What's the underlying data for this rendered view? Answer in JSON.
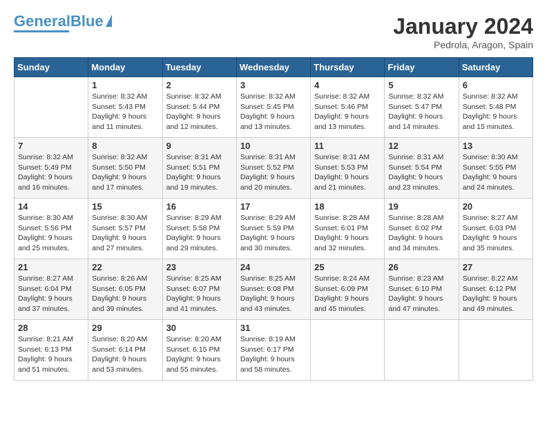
{
  "header": {
    "logo_general": "General",
    "logo_blue": "Blue",
    "month_title": "January 2024",
    "subtitle": "Pedrola, Aragon, Spain"
  },
  "weekdays": [
    "Sunday",
    "Monday",
    "Tuesday",
    "Wednesday",
    "Thursday",
    "Friday",
    "Saturday"
  ],
  "weeks": [
    [
      {
        "day": "",
        "sunrise": "",
        "sunset": "",
        "daylight": ""
      },
      {
        "day": "1",
        "sunrise": "Sunrise: 8:32 AM",
        "sunset": "Sunset: 5:43 PM",
        "daylight": "Daylight: 9 hours and 11 minutes."
      },
      {
        "day": "2",
        "sunrise": "Sunrise: 8:32 AM",
        "sunset": "Sunset: 5:44 PM",
        "daylight": "Daylight: 9 hours and 12 minutes."
      },
      {
        "day": "3",
        "sunrise": "Sunrise: 8:32 AM",
        "sunset": "Sunset: 5:45 PM",
        "daylight": "Daylight: 9 hours and 13 minutes."
      },
      {
        "day": "4",
        "sunrise": "Sunrise: 8:32 AM",
        "sunset": "Sunset: 5:46 PM",
        "daylight": "Daylight: 9 hours and 13 minutes."
      },
      {
        "day": "5",
        "sunrise": "Sunrise: 8:32 AM",
        "sunset": "Sunset: 5:47 PM",
        "daylight": "Daylight: 9 hours and 14 minutes."
      },
      {
        "day": "6",
        "sunrise": "Sunrise: 8:32 AM",
        "sunset": "Sunset: 5:48 PM",
        "daylight": "Daylight: 9 hours and 15 minutes."
      }
    ],
    [
      {
        "day": "7",
        "sunrise": "Sunrise: 8:32 AM",
        "sunset": "Sunset: 5:49 PM",
        "daylight": "Daylight: 9 hours and 16 minutes."
      },
      {
        "day": "8",
        "sunrise": "Sunrise: 8:32 AM",
        "sunset": "Sunset: 5:50 PM",
        "daylight": "Daylight: 9 hours and 17 minutes."
      },
      {
        "day": "9",
        "sunrise": "Sunrise: 8:31 AM",
        "sunset": "Sunset: 5:51 PM",
        "daylight": "Daylight: 9 hours and 19 minutes."
      },
      {
        "day": "10",
        "sunrise": "Sunrise: 8:31 AM",
        "sunset": "Sunset: 5:52 PM",
        "daylight": "Daylight: 9 hours and 20 minutes."
      },
      {
        "day": "11",
        "sunrise": "Sunrise: 8:31 AM",
        "sunset": "Sunset: 5:53 PM",
        "daylight": "Daylight: 9 hours and 21 minutes."
      },
      {
        "day": "12",
        "sunrise": "Sunrise: 8:31 AM",
        "sunset": "Sunset: 5:54 PM",
        "daylight": "Daylight: 9 hours and 23 minutes."
      },
      {
        "day": "13",
        "sunrise": "Sunrise: 8:30 AM",
        "sunset": "Sunset: 5:55 PM",
        "daylight": "Daylight: 9 hours and 24 minutes."
      }
    ],
    [
      {
        "day": "14",
        "sunrise": "Sunrise: 8:30 AM",
        "sunset": "Sunset: 5:56 PM",
        "daylight": "Daylight: 9 hours and 25 minutes."
      },
      {
        "day": "15",
        "sunrise": "Sunrise: 8:30 AM",
        "sunset": "Sunset: 5:57 PM",
        "daylight": "Daylight: 9 hours and 27 minutes."
      },
      {
        "day": "16",
        "sunrise": "Sunrise: 8:29 AM",
        "sunset": "Sunset: 5:58 PM",
        "daylight": "Daylight: 9 hours and 29 minutes."
      },
      {
        "day": "17",
        "sunrise": "Sunrise: 8:29 AM",
        "sunset": "Sunset: 5:59 PM",
        "daylight": "Daylight: 9 hours and 30 minutes."
      },
      {
        "day": "18",
        "sunrise": "Sunrise: 8:28 AM",
        "sunset": "Sunset: 6:01 PM",
        "daylight": "Daylight: 9 hours and 32 minutes."
      },
      {
        "day": "19",
        "sunrise": "Sunrise: 8:28 AM",
        "sunset": "Sunset: 6:02 PM",
        "daylight": "Daylight: 9 hours and 34 minutes."
      },
      {
        "day": "20",
        "sunrise": "Sunrise: 8:27 AM",
        "sunset": "Sunset: 6:03 PM",
        "daylight": "Daylight: 9 hours and 35 minutes."
      }
    ],
    [
      {
        "day": "21",
        "sunrise": "Sunrise: 8:27 AM",
        "sunset": "Sunset: 6:04 PM",
        "daylight": "Daylight: 9 hours and 37 minutes."
      },
      {
        "day": "22",
        "sunrise": "Sunrise: 8:26 AM",
        "sunset": "Sunset: 6:05 PM",
        "daylight": "Daylight: 9 hours and 39 minutes."
      },
      {
        "day": "23",
        "sunrise": "Sunrise: 8:25 AM",
        "sunset": "Sunset: 6:07 PM",
        "daylight": "Daylight: 9 hours and 41 minutes."
      },
      {
        "day": "24",
        "sunrise": "Sunrise: 8:25 AM",
        "sunset": "Sunset: 6:08 PM",
        "daylight": "Daylight: 9 hours and 43 minutes."
      },
      {
        "day": "25",
        "sunrise": "Sunrise: 8:24 AM",
        "sunset": "Sunset: 6:09 PM",
        "daylight": "Daylight: 9 hours and 45 minutes."
      },
      {
        "day": "26",
        "sunrise": "Sunrise: 8:23 AM",
        "sunset": "Sunset: 6:10 PM",
        "daylight": "Daylight: 9 hours and 47 minutes."
      },
      {
        "day": "27",
        "sunrise": "Sunrise: 8:22 AM",
        "sunset": "Sunset: 6:12 PM",
        "daylight": "Daylight: 9 hours and 49 minutes."
      }
    ],
    [
      {
        "day": "28",
        "sunrise": "Sunrise: 8:21 AM",
        "sunset": "Sunset: 6:13 PM",
        "daylight": "Daylight: 9 hours and 51 minutes."
      },
      {
        "day": "29",
        "sunrise": "Sunrise: 8:20 AM",
        "sunset": "Sunset: 6:14 PM",
        "daylight": "Daylight: 9 hours and 53 minutes."
      },
      {
        "day": "30",
        "sunrise": "Sunrise: 8:20 AM",
        "sunset": "Sunset: 6:15 PM",
        "daylight": "Daylight: 9 hours and 55 minutes."
      },
      {
        "day": "31",
        "sunrise": "Sunrise: 8:19 AM",
        "sunset": "Sunset: 6:17 PM",
        "daylight": "Daylight: 9 hours and 58 minutes."
      },
      {
        "day": "",
        "sunrise": "",
        "sunset": "",
        "daylight": ""
      },
      {
        "day": "",
        "sunrise": "",
        "sunset": "",
        "daylight": ""
      },
      {
        "day": "",
        "sunrise": "",
        "sunset": "",
        "daylight": ""
      }
    ]
  ]
}
